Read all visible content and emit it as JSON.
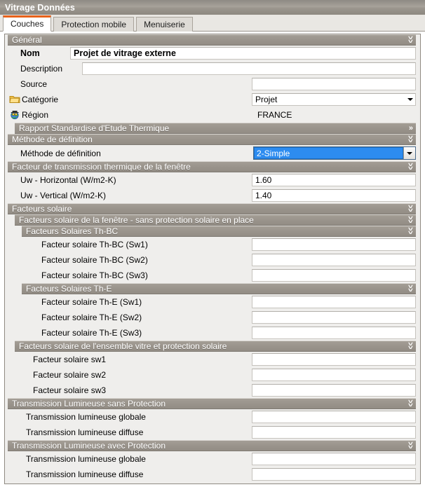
{
  "window": {
    "title": "Vitrage Données"
  },
  "tabs": [
    {
      "label": "Couches",
      "active": true
    },
    {
      "label": "Protection mobile",
      "active": false
    },
    {
      "label": "Menuiserie",
      "active": false
    }
  ],
  "colors": {
    "accent_orange": "#e8621a",
    "header_gray": "#9a948c",
    "selection_blue": "#2d8cf0",
    "panel_bg": "#efeeec",
    "titlebar_gray": "#9b968e"
  },
  "sections": {
    "general": {
      "label": "Général",
      "chevron": "double-chevron-down"
    },
    "rapport": {
      "label": "Rapport Standardise d'Etude Thermique",
      "chevron": "double-chevron-right"
    },
    "methode": {
      "label": "Méthode de définition",
      "chevron": "double-chevron-down"
    },
    "facteur_transmission": {
      "label": "Facteur de transmission thermique de la fenêtre",
      "chevron": "double-chevron-down"
    },
    "facteurs_solaire": {
      "label": "Facteurs solaire",
      "chevron": "double-chevron-down"
    },
    "facteurs_solaire_fenetre": {
      "label": "Facteurs solaire de la fenêtre - sans protection solaire en place",
      "chevron": "double-chevron-down"
    },
    "facteurs_thbc": {
      "label": "Facteurs Solaires Th-BC",
      "chevron": "double-chevron-down"
    },
    "facteurs_the": {
      "label": "Facteurs Solaires Th-E",
      "chevron": "double-chevron-down"
    },
    "facteurs_ensemble": {
      "label": "Facteurs solaire de l'ensemble vitre et protection solaire",
      "chevron": "double-chevron-down"
    },
    "transmission_sans": {
      "label": "Transmission Lumineuse sans Protection",
      "chevron": "double-chevron-down"
    },
    "transmission_avec": {
      "label": "Transmission Lumineuse avec Protection",
      "chevron": "double-chevron-down"
    }
  },
  "fields": {
    "nom": {
      "label": "Nom",
      "value": "Projet de vitrage externe"
    },
    "description": {
      "label": "Description",
      "value": ""
    },
    "source": {
      "label": "Source",
      "value": ""
    },
    "categorie": {
      "label": "Catégorie",
      "value": "Projet",
      "icon": "folder-icon"
    },
    "region": {
      "label": "Région",
      "value": "FRANCE",
      "icon": "globe-icon"
    },
    "methode_definition": {
      "label": "Méthode de définition",
      "value": "2-Simple",
      "selected": true
    },
    "uw_horizontal": {
      "label": "Uw - Horizontal (W/m2-K)",
      "value": "1.60"
    },
    "uw_vertical": {
      "label": "Uw - Vertical (W/m2-K)",
      "value": "1.40"
    },
    "fs_thbc_sw1": {
      "label": "Facteur solaire Th-BC (Sw1)",
      "value": ""
    },
    "fs_thbc_sw2": {
      "label": "Facteur solaire Th-BC (Sw2)",
      "value": ""
    },
    "fs_thbc_sw3": {
      "label": "Facteur solaire Th-BC (Sw3)",
      "value": ""
    },
    "fs_the_sw1": {
      "label": "Facteur solaire Th-E (Sw1)",
      "value": ""
    },
    "fs_the_sw2": {
      "label": "Facteur solaire Th-E (Sw2)",
      "value": ""
    },
    "fs_the_sw3": {
      "label": "Facteur solaire Th-E (Sw3)",
      "value": ""
    },
    "fs_sw1": {
      "label": "Facteur solaire sw1",
      "value": ""
    },
    "fs_sw2": {
      "label": "Facteur solaire sw2",
      "value": ""
    },
    "fs_sw3": {
      "label": "Facteur solaire sw3",
      "value": ""
    },
    "tl_sans_globale": {
      "label": "Transmission lumineuse globale",
      "value": ""
    },
    "tl_sans_diffuse": {
      "label": "Transmission lumineuse diffuse",
      "value": ""
    },
    "tl_avec_globale": {
      "label": "Transmission lumineuse globale",
      "value": ""
    },
    "tl_avec_diffuse": {
      "label": "Transmission lumineuse diffuse",
      "value": ""
    }
  }
}
